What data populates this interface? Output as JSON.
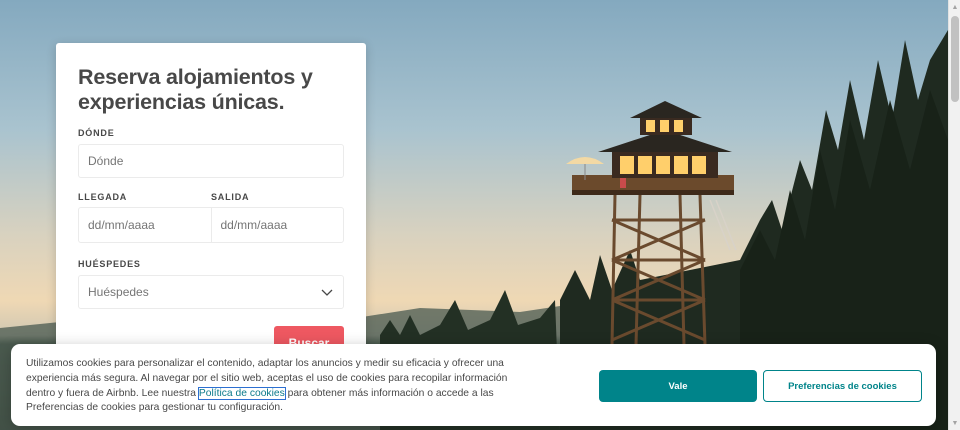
{
  "hero": {
    "title": "Reserva alojamientos y experiencias únicas."
  },
  "search": {
    "where_label": "DÓNDE",
    "where_placeholder": "Dónde",
    "checkin_label": "LLEGADA",
    "checkin_placeholder": "dd/mm/aaaa",
    "checkout_label": "SALIDA",
    "checkout_placeholder": "dd/mm/aaaa",
    "guests_label": "HUÉSPEDES",
    "guests_value": "Huéspedes",
    "search_button": "Buscar"
  },
  "cookie_banner": {
    "text_before": "Utilizamos cookies para personalizar el contenido, adaptar los anuncios y medir su eficacia y ofrecer una experiencia más segura. Al navegar por el sitio web, aceptas el uso de cookies para recopilar información dentro y fuera de Airbnb. Lee nuestra ",
    "link_text": "Política de cookies",
    "text_after": " para obtener más información o accede a las Preferencias de cookies para gestionar tu configuración.",
    "accept_button": "Vale",
    "preferences_button": "Preferencias de cookies"
  },
  "colors": {
    "brand": "#ff5a5f",
    "teal": "#00848a"
  },
  "icons": {
    "guests_dropdown": "chevron-down-icon"
  }
}
